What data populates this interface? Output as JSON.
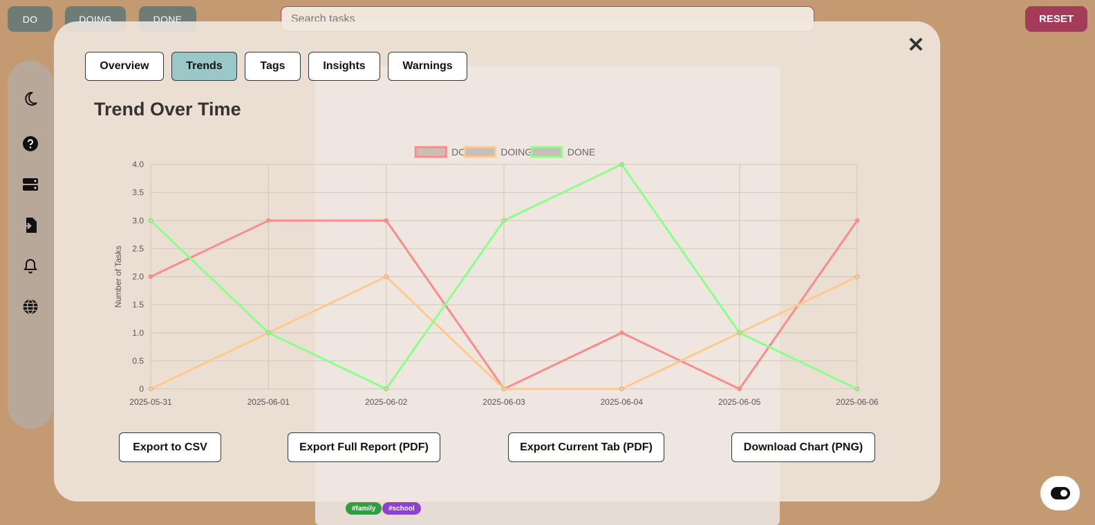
{
  "topbar": {
    "filters": [
      {
        "label": "DO"
      },
      {
        "label": "DOING"
      },
      {
        "label": "DONE"
      }
    ],
    "search_placeholder": "Search tasks",
    "reset_label": "RESET"
  },
  "sidebar": {
    "icons": [
      "moon-icon",
      "help-icon",
      "storage-icon",
      "import-icon",
      "bell-icon",
      "globe-icon"
    ]
  },
  "background": {
    "tags": [
      {
        "label": "#family",
        "color": "#2e9e3e"
      },
      {
        "label": "#school",
        "color": "#8e3fd4"
      }
    ]
  },
  "modal": {
    "tabs": [
      {
        "label": "Overview"
      },
      {
        "label": "Trends",
        "active": true
      },
      {
        "label": "Tags"
      },
      {
        "label": "Insights"
      },
      {
        "label": "Warnings"
      }
    ],
    "close_symbol": "✕",
    "chart_title": "Trend Over Time",
    "exports": [
      {
        "label": "Export to CSV"
      },
      {
        "label": "Export Full Report (PDF)"
      },
      {
        "label": "Export Current Tab (PDF)"
      },
      {
        "label": "Download Chart (PNG)"
      }
    ]
  },
  "chart_data": {
    "type": "line",
    "x": [
      "2025-05-31",
      "2025-06-01",
      "2025-06-02",
      "2025-06-03",
      "2025-06-04",
      "2025-06-05",
      "2025-06-06"
    ],
    "series": [
      {
        "name": "DO",
        "color": "#ff8a8a",
        "values": [
          2,
          3,
          3,
          0,
          1,
          0,
          3
        ]
      },
      {
        "name": "DOING",
        "color": "#ffc98a",
        "values": [
          0,
          1,
          2,
          0,
          0,
          1,
          2
        ]
      },
      {
        "name": "DONE",
        "color": "#8aff8a",
        "values": [
          3,
          1,
          0,
          3,
          4,
          1,
          0
        ]
      }
    ],
    "ylabel": "Number of Tasks",
    "yticks": [
      "0",
      "0.5",
      "1.0",
      "1.5",
      "2.0",
      "2.5",
      "3.0",
      "3.5",
      "4.0"
    ],
    "ylim": [
      0,
      4
    ],
    "grid": true,
    "legend": "top-center"
  }
}
